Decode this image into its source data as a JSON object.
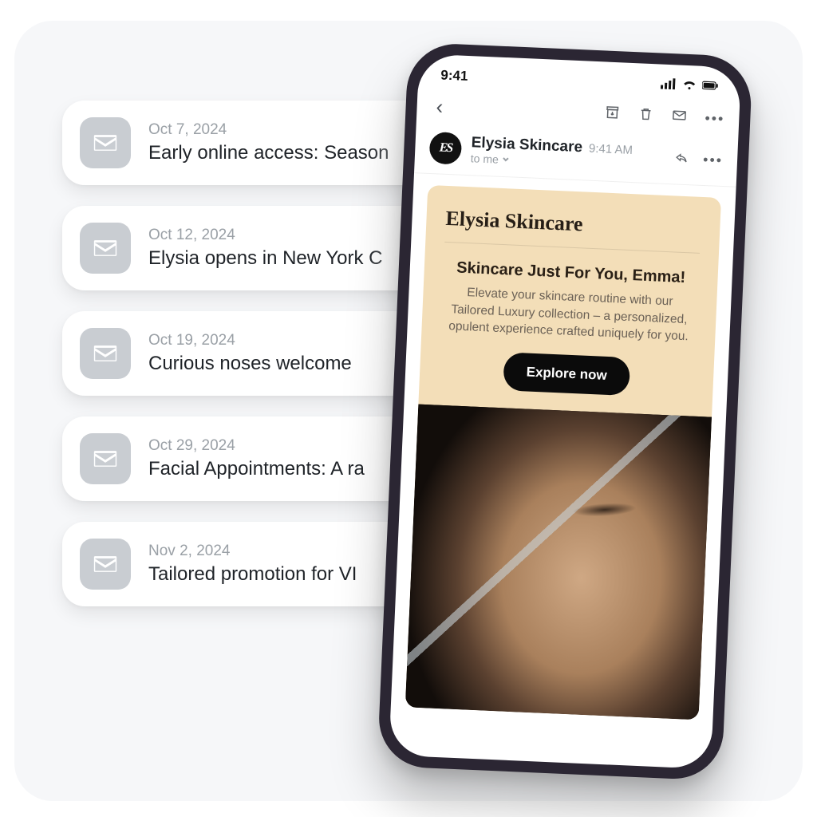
{
  "list": [
    {
      "date": "Oct 7, 2024",
      "subject": "Early online access: Season"
    },
    {
      "date": "Oct 12, 2024",
      "subject": "Elysia opens in New York C"
    },
    {
      "date": "Oct 19, 2024",
      "subject": "Curious noses welcome"
    },
    {
      "date": "Oct 29, 2024",
      "subject": "Facial Appointments: A ra"
    },
    {
      "date": "Nov 2, 2024",
      "subject": "Tailored promotion for VI"
    }
  ],
  "phone": {
    "status_time": "9:41",
    "sender_name": "Elysia Skincare",
    "sender_time": "9:41 AM",
    "avatar_initials": "ES",
    "recipient_line": "to me",
    "brand": "Elysia Skincare",
    "headline": "Skincare Just For You, Emma!",
    "body": "Elevate your skincare routine with our Tailored Luxury collection – a personalized, opulent experience crafted uniquely for you.",
    "cta": "Explore now"
  }
}
